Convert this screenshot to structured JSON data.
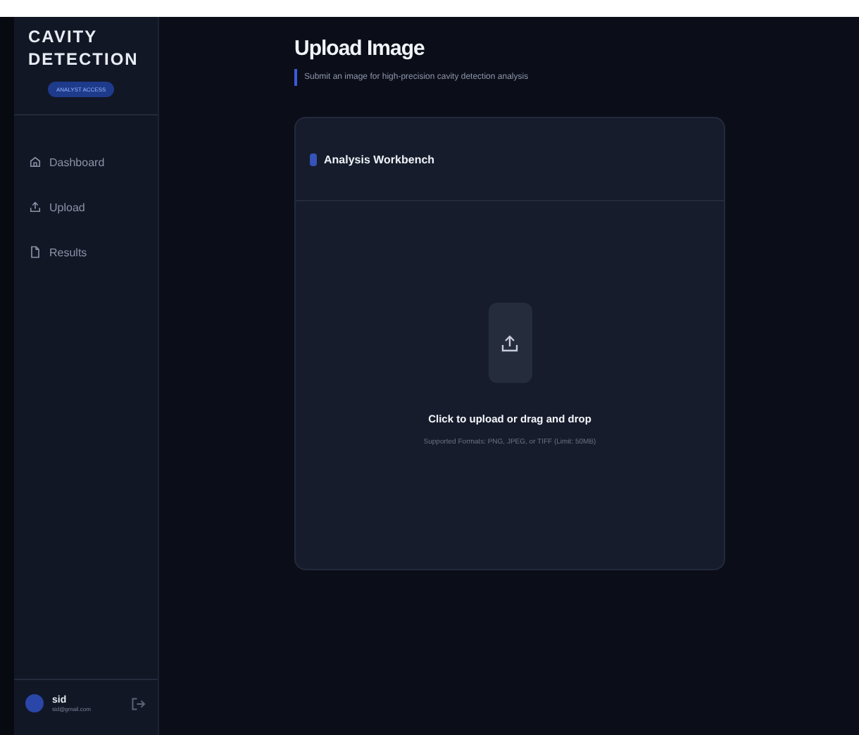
{
  "brand": {
    "title": "CAVITY DETECTION",
    "badge": "ANALYST ACCESS"
  },
  "nav": [
    {
      "label": "Dashboard",
      "selected": false
    },
    {
      "label": "Upload",
      "selected": false
    },
    {
      "label": "Results",
      "selected": false
    }
  ],
  "user": {
    "name": "sid",
    "email": "sid@gmail.com"
  },
  "header": {
    "title": "Upload Image",
    "subtitle": "Submit an image for high-precision cavity detection analysis"
  },
  "card": {
    "title": "Analysis Workbench",
    "prompt": "Click to upload or drag and drop",
    "hint": "Supported Formats: PNG, JPEG, or TIFF (Limit: 50MB)"
  }
}
